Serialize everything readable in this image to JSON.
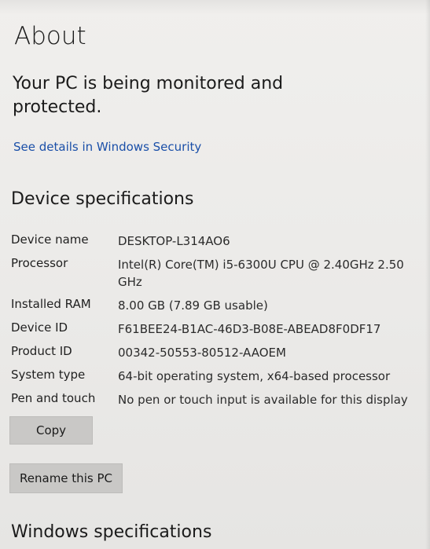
{
  "page": {
    "title": "About"
  },
  "security": {
    "status_text": "Your PC is being monitored and protected.",
    "link_text": "See details in Windows Security"
  },
  "device_specs": {
    "heading": "Device specifications",
    "rows": [
      {
        "label": "Device name",
        "value": "DESKTOP-L314AO6"
      },
      {
        "label": "Processor",
        "value": "Intel(R) Core(TM) i5-6300U CPU @ 2.40GHz 2.50 GHz"
      },
      {
        "label": "Installed RAM",
        "value": "8.00 GB (7.89 GB usable)"
      },
      {
        "label": "Device ID",
        "value": "F61BEE24-B1AC-46D3-B08E-ABEAD8F0DF17"
      },
      {
        "label": "Product ID",
        "value": "00342-50553-80512-AAOEM"
      },
      {
        "label": "System type",
        "value": "64-bit operating system, x64-based processor"
      },
      {
        "label": "Pen and touch",
        "value": "No pen or touch input is available for this display"
      }
    ]
  },
  "buttons": {
    "copy": "Copy",
    "rename": "Rename this PC"
  },
  "windows_specs": {
    "heading": "Windows specifications"
  }
}
